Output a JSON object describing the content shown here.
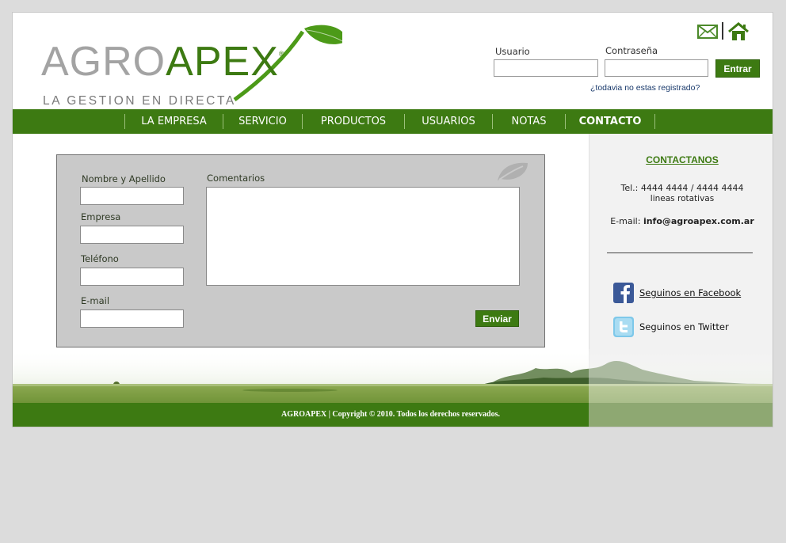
{
  "brand": {
    "logo_agro": "AGRO",
    "logo_apex": "APEX",
    "logo_reg": "®",
    "tagline": "LA GESTION EN DIRECTA",
    "accent_color": "#3d7a12"
  },
  "header": {
    "mail_icon": "envelope-icon",
    "home_icon": "home-icon",
    "login": {
      "user_label": "Usuario",
      "user_value": "",
      "password_label": "Contraseña",
      "password_value": "",
      "submit_label": "Entrar",
      "register_link": "¿todavia no estas registrado?"
    }
  },
  "nav": {
    "items": [
      {
        "label": "LA EMPRESA"
      },
      {
        "label": "SERVICIO"
      },
      {
        "label": "PRODUCTOS"
      },
      {
        "label": "USUARIOS"
      },
      {
        "label": "NOTAS"
      },
      {
        "label": "CONTACTO",
        "active": true
      }
    ]
  },
  "form": {
    "name_label": "Nombre y Apellido",
    "company_label": "Empresa",
    "phone_label": "Teléfono",
    "email_label": "E-mail",
    "comments_label": "Comentarios",
    "submit_label": "Enviar"
  },
  "sidebar": {
    "title": "CONTACTANOS",
    "phone": "Tel.: 4444 4444 / 4444 4444",
    "phone_note": "lineas rotativas",
    "email_prefix": "E-mail: ",
    "email": "info@agroapex.com.ar",
    "facebook_label": "Seguinos en Facebook",
    "twitter_label": "Seguinos en Twitter"
  },
  "footer": {
    "text": "AGROAPEX | Copyright © 2010. Todos los derechos reservados."
  }
}
